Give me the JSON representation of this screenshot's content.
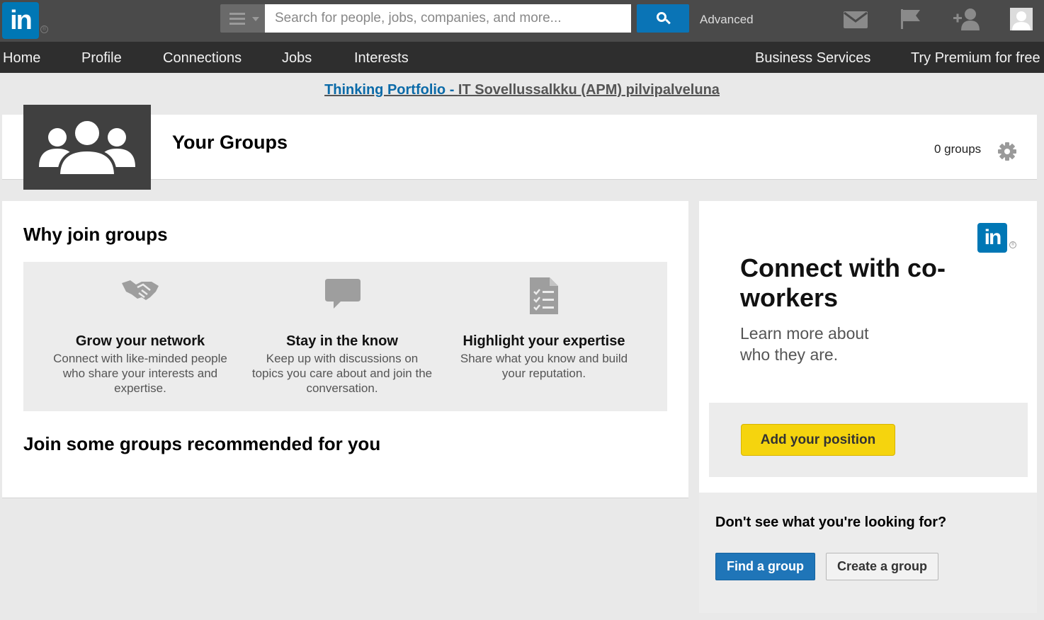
{
  "header": {
    "logo_text": "in",
    "search": {
      "placeholder": "Search for people, jobs, companies, and more...",
      "value": ""
    },
    "advanced_label": "Advanced",
    "icons": [
      "messages-icon",
      "notifications-flag-icon",
      "add-connections-icon",
      "profile-avatar-icon"
    ]
  },
  "nav": {
    "home": "Home",
    "profile": "Profile",
    "connections": "Connections",
    "jobs": "Jobs",
    "interests": "Interests",
    "business": "Business Services",
    "premium": "Try Premium for free"
  },
  "promo": {
    "link_part1": "Thinking Portfolio - ",
    "link_part2": "IT Sovellussalkku (APM) pilvipalveluna"
  },
  "groups_header": {
    "title": "Your Groups",
    "count": "0 groups"
  },
  "why": {
    "title": "Why join groups",
    "benefits": [
      {
        "icon": "handshake-icon",
        "title": "Grow your network",
        "desc": "Connect with like-minded people who share your interests and expertise."
      },
      {
        "icon": "speech-bubble-icon",
        "title": "Stay in the know",
        "desc": "Keep up with discussions on topics you care about and join the conversation."
      },
      {
        "icon": "checklist-document-icon",
        "title": "Highlight your expertise",
        "desc": "Share what you know and build your reputation."
      }
    ]
  },
  "recommend": {
    "title": "Join some groups recommended for you"
  },
  "ad": {
    "logo_text": "in",
    "headline": "Connect with co-workers",
    "sub": "Learn more about who they are.",
    "cta": "Add your position"
  },
  "find": {
    "title": "Don't see what you're looking for?",
    "find_button": "Find a group",
    "create_button": "Create a group"
  },
  "colors": {
    "brand_blue": "#0077b5",
    "topbar": "#4a4a4a",
    "navbar": "#2e2e2e",
    "cta_yellow": "#f5d40e",
    "primary_button": "#1f75b8"
  }
}
